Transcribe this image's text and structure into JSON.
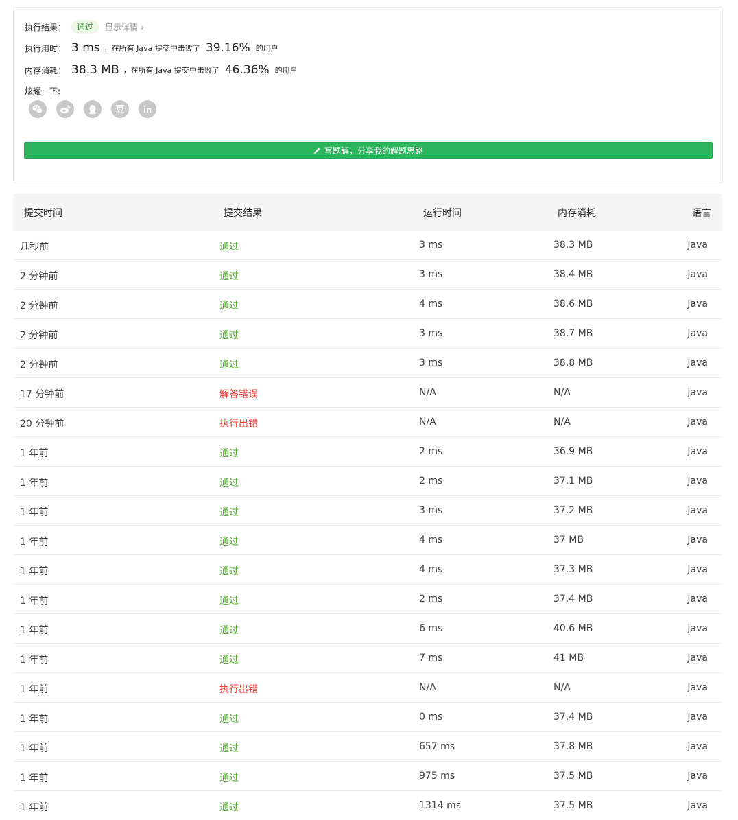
{
  "result": {
    "status_label": "执行结果：",
    "status_value": "通过",
    "details_link": "显示详情 ›",
    "runtime_label": "执行用时：",
    "runtime_value": "3 ms",
    "runtime_desc": "，在所有 Java 提交中击败了",
    "runtime_pct": "39.16%",
    "runtime_suffix": "的用户",
    "memory_label": "内存消耗：",
    "memory_value": "38.3 MB",
    "memory_desc": "，在所有 Java 提交中击败了",
    "memory_pct": "46.36%",
    "memory_suffix": "的用户",
    "share_label": "炫耀一下:",
    "share_icons": [
      "wechat-icon",
      "weibo-icon",
      "qq-icon",
      "douban-icon",
      "linkedin-icon"
    ],
    "write_button": "写题解，分享我的解题思路"
  },
  "table": {
    "headers": [
      "提交时间",
      "提交结果",
      "运行时间",
      "内存消耗",
      "语言"
    ],
    "rows": [
      {
        "time": "几秒前",
        "result": "通过",
        "ok": true,
        "runtime": "3 ms",
        "memory": "38.3 MB",
        "lang": "Java"
      },
      {
        "time": "2 分钟前",
        "result": "通过",
        "ok": true,
        "runtime": "3 ms",
        "memory": "38.4 MB",
        "lang": "Java"
      },
      {
        "time": "2 分钟前",
        "result": "通过",
        "ok": true,
        "runtime": "4 ms",
        "memory": "38.6 MB",
        "lang": "Java"
      },
      {
        "time": "2 分钟前",
        "result": "通过",
        "ok": true,
        "runtime": "3 ms",
        "memory": "38.7 MB",
        "lang": "Java"
      },
      {
        "time": "2 分钟前",
        "result": "通过",
        "ok": true,
        "runtime": "3 ms",
        "memory": "38.8 MB",
        "lang": "Java"
      },
      {
        "time": "17 分钟前",
        "result": "解答错误",
        "ok": false,
        "runtime": "N/A",
        "memory": "N/A",
        "lang": "Java"
      },
      {
        "time": "20 分钟前",
        "result": "执行出错",
        "ok": false,
        "runtime": "N/A",
        "memory": "N/A",
        "lang": "Java"
      },
      {
        "time": "1 年前",
        "result": "通过",
        "ok": true,
        "runtime": "2 ms",
        "memory": "36.9 MB",
        "lang": "Java"
      },
      {
        "time": "1 年前",
        "result": "通过",
        "ok": true,
        "runtime": "2 ms",
        "memory": "37.1 MB",
        "lang": "Java"
      },
      {
        "time": "1 年前",
        "result": "通过",
        "ok": true,
        "runtime": "3 ms",
        "memory": "37.2 MB",
        "lang": "Java"
      },
      {
        "time": "1 年前",
        "result": "通过",
        "ok": true,
        "runtime": "4 ms",
        "memory": "37 MB",
        "lang": "Java"
      },
      {
        "time": "1 年前",
        "result": "通过",
        "ok": true,
        "runtime": "4 ms",
        "memory": "37.3 MB",
        "lang": "Java"
      },
      {
        "time": "1 年前",
        "result": "通过",
        "ok": true,
        "runtime": "2 ms",
        "memory": "37.4 MB",
        "lang": "Java"
      },
      {
        "time": "1 年前",
        "result": "通过",
        "ok": true,
        "runtime": "6 ms",
        "memory": "40.6 MB",
        "lang": "Java"
      },
      {
        "time": "1 年前",
        "result": "通过",
        "ok": true,
        "runtime": "7 ms",
        "memory": "41 MB",
        "lang": "Java"
      },
      {
        "time": "1 年前",
        "result": "执行出错",
        "ok": false,
        "runtime": "N/A",
        "memory": "N/A",
        "lang": "Java"
      },
      {
        "time": "1 年前",
        "result": "通过",
        "ok": true,
        "runtime": "0 ms",
        "memory": "37.4 MB",
        "lang": "Java"
      },
      {
        "time": "1 年前",
        "result": "通过",
        "ok": true,
        "runtime": "657 ms",
        "memory": "37.8 MB",
        "lang": "Java"
      },
      {
        "time": "1 年前",
        "result": "通过",
        "ok": true,
        "runtime": "975 ms",
        "memory": "37.5 MB",
        "lang": "Java"
      },
      {
        "time": "1 年前",
        "result": "通过",
        "ok": true,
        "runtime": "1314 ms",
        "memory": "37.5 MB",
        "lang": "Java"
      }
    ]
  },
  "colors": {
    "accepted": "#4fa62c",
    "error": "#ef3a2e",
    "button": "#2db55d"
  }
}
